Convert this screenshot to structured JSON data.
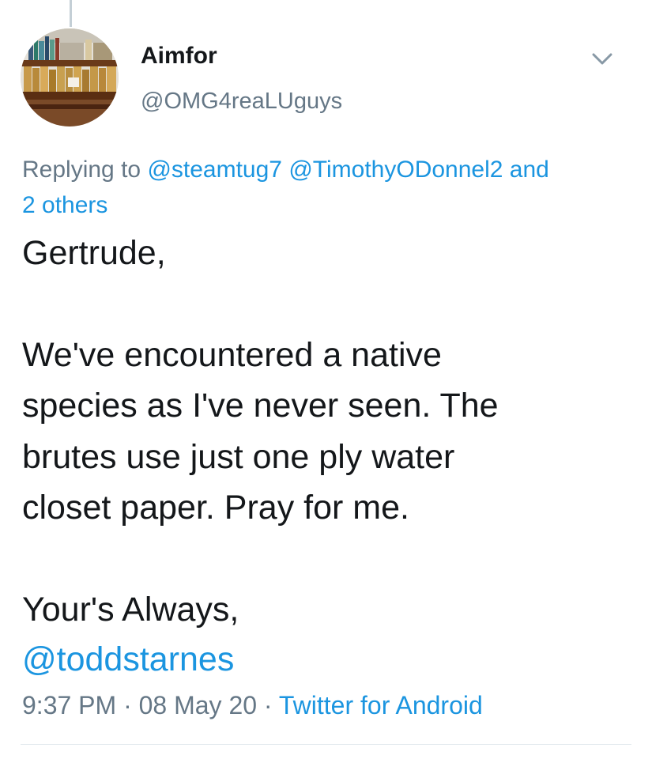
{
  "author": {
    "name": "Aimfor",
    "handle": "@OMG4reaLUguys"
  },
  "reply": {
    "prefix": "Replying to ",
    "mention1": "@steamtug7",
    "mention2": "@TimothyODonnel2",
    "joiner": " and",
    "others": "2 others"
  },
  "tweet": {
    "body": "Gertrude,\n\nWe've encountered a native\nspecies as I've never seen. The\nbrutes use just one ply water\ncloset paper. Pray for me.\n\nYour's Always,",
    "mention": "@toddstarnes"
  },
  "meta": {
    "time": "9:37 PM",
    "separator": " · ",
    "date": "08 May 20",
    "source": "Twitter for Android"
  },
  "icons": {
    "menu": "chevron-down-icon",
    "avatar": "bookshelf-avatar"
  },
  "colors": {
    "link": "#1b95e0",
    "secondary": "#657786",
    "text": "#14171a"
  }
}
